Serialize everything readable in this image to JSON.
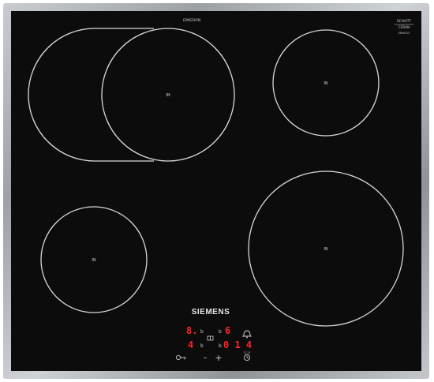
{
  "brand": "SIEMENS",
  "top_label": "EMISSION",
  "schott": {
    "line1": "SCHOTT",
    "line2": "CERAN",
    "line3": "ER00013"
  },
  "zones": {
    "front_left": "IN",
    "back_right": "IN",
    "rear_left": "IN",
    "front_right": "IN"
  },
  "display": {
    "left_top": "8.",
    "left_bottom": "4",
    "right_top": "6",
    "right_bottom": "0 1 4",
    "b_labels": [
      "b",
      "b",
      "b",
      "b"
    ],
    "timer_label": "1111"
  },
  "controls": {
    "minus": "–",
    "plus": "+"
  },
  "icons": [
    "key-lock-icon",
    "bell-icon",
    "timer-icon",
    "double-zone-icon"
  ],
  "colors": {
    "glass": "#0c0c0d",
    "frame": "#b4b7bb",
    "display": "#ff2424",
    "zone_line": "#d8d8d8"
  }
}
